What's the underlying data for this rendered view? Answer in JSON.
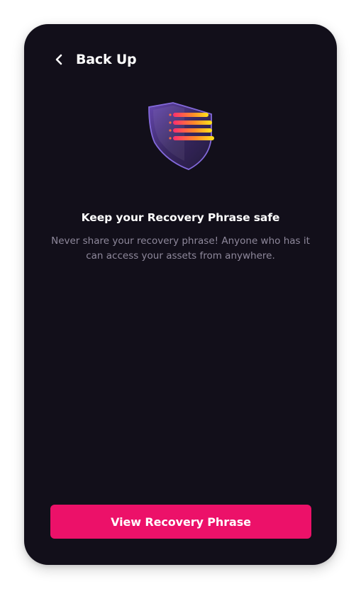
{
  "header": {
    "back_icon": "chevron-left-icon",
    "title": "Back Up"
  },
  "hero": {
    "icon": "shield-icon"
  },
  "content": {
    "title": "Keep your Recovery Phrase safe",
    "description": "Never share your recovery phrase! Anyone who has it can access your assets from anywhere."
  },
  "actions": {
    "view_label": "View Recovery Phrase"
  },
  "colors": {
    "background": "#120f1a",
    "accent": "#ec1169",
    "muted_text": "#8e889b"
  }
}
